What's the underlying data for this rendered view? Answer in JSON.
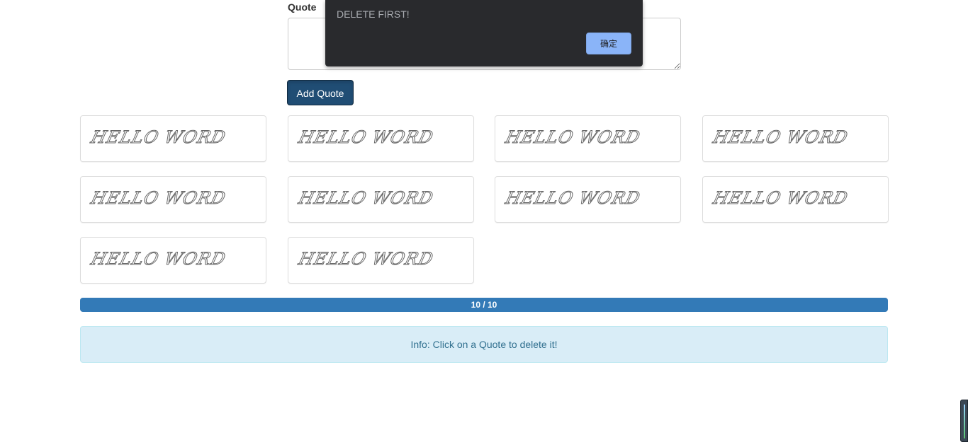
{
  "form": {
    "quote_label": "Quote",
    "quote_value": "",
    "add_button_label": "Add Quote"
  },
  "quotes": [
    {
      "text": "HELLO WORD"
    },
    {
      "text": "HELLO WORD"
    },
    {
      "text": "HELLO WORD"
    },
    {
      "text": "HELLO WORD"
    },
    {
      "text": "HELLO WORD"
    },
    {
      "text": "HELLO WORD"
    },
    {
      "text": "HELLO WORD"
    },
    {
      "text": "HELLO WORD"
    },
    {
      "text": "HELLO WORD"
    },
    {
      "text": "HELLO WORD"
    }
  ],
  "progress": {
    "label": "10 / 10",
    "current": 10,
    "max": 10,
    "color": "#337ab7"
  },
  "info": {
    "text": "Info: Click on a Quote to delete it!"
  },
  "dialog": {
    "message": "DELETE FIRST!",
    "ok_label": "确定"
  }
}
